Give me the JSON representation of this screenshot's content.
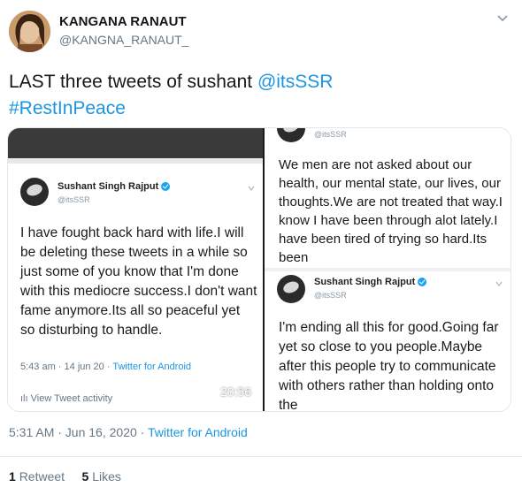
{
  "author": {
    "name": "KANGANA RANAUT",
    "handle": "@KANGNA_RANAUT_"
  },
  "tweet": {
    "text_prefix": "LAST three tweets of sushant ",
    "mention": "@itsSSR",
    "hashtag": "#RestInPeace"
  },
  "media": {
    "left_card": {
      "author_name": "Sushant Singh Rajput",
      "author_handle": "@itsSSR",
      "body": "I have fought back hard with life.I will be deleting these tweets in a while so just some of you know that I'm done with this mediocre success.I don't want fame anymore.Its all so peaceful yet so disturbing to handle.",
      "time": "5:43 am · 14 jun 20 · ",
      "source": "Twitter for Android",
      "video_stamp": "20:56",
      "activity": "View Tweet activity"
    },
    "right_top_card": {
      "author_handle": "@itsSSR",
      "body": "We men are not asked about our health, our mental state, our lives, our thoughts.We are not treated that way.I know I have been through alot lately.I have been tired of trying so hard.Its been"
    },
    "right_bottom_card": {
      "author_name": "Sushant Singh Rajput",
      "author_handle": "@itsSSR",
      "body": "I'm ending all this for good.Going far yet so close to you people.Maybe after this people try to communicate with others rather than holding onto the"
    }
  },
  "footer": {
    "time": "5:31 AM · Jun 16, 2020 · ",
    "source": "Twitter for Android",
    "retweet_count": "1",
    "retweet_label": "Retweet",
    "like_count": "5",
    "like_label": "Likes"
  },
  "colors": {
    "link": "#1b95e0",
    "muted": "#657786",
    "text": "#14171a"
  }
}
